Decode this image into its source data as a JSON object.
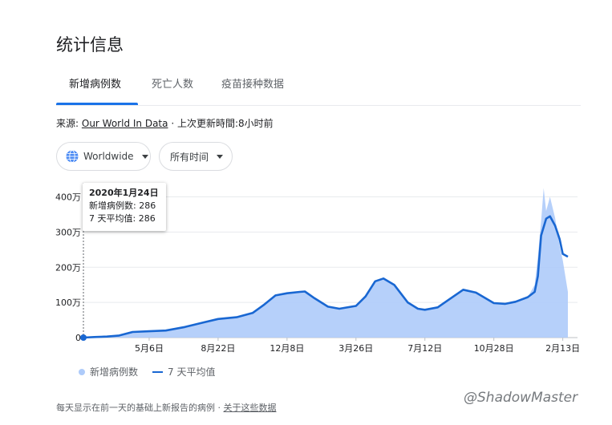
{
  "title": "统计信息",
  "tabs": [
    {
      "label": "新增病例数",
      "active": true
    },
    {
      "label": "死亡人数",
      "active": false
    },
    {
      "label": "疫苗接种数据",
      "active": false
    }
  ],
  "source": {
    "prefix": "来源:",
    "link": "Our World In Data",
    "sep": "·",
    "updated": "上次更新時間:",
    "age": "8小时前"
  },
  "filters": {
    "region": "Worldwide",
    "range": "所有时间"
  },
  "tooltip": {
    "date": "2020年1月24日",
    "cases_label": "新增病例数:",
    "cases_value": "286",
    "avg_label": "7 天平均值:",
    "avg_value": "286"
  },
  "legend": {
    "bars": "新增病例数",
    "line": "7 天平均值"
  },
  "footer": {
    "note": "每天显示在前一天的基础上新报告的病例",
    "sep": "·",
    "link": "关于这些数据"
  },
  "watermark": "@ShadowMaster",
  "colors": {
    "accent": "#1a73e8",
    "bars": "#aecbfa",
    "line": "#1967d2"
  },
  "chart_data": {
    "type": "area",
    "ylim": [
      0,
      4400000
    ],
    "y_ticks": [
      {
        "value": 0,
        "label": "0"
      },
      {
        "value": 1000000,
        "label": "100万"
      },
      {
        "value": 2000000,
        "label": "200万"
      },
      {
        "value": 3000000,
        "label": "300万"
      },
      {
        "value": 4000000,
        "label": "400万"
      }
    ],
    "x_range": [
      "2020-01-24",
      "2022-02-21"
    ],
    "x_ticks": [
      {
        "date": "2020-05-06",
        "label": "5月6日"
      },
      {
        "date": "2020-08-22",
        "label": "8月22日"
      },
      {
        "date": "2020-12-08",
        "label": "12月8日"
      },
      {
        "date": "2021-03-26",
        "label": "3月26日"
      },
      {
        "date": "2021-07-12",
        "label": "7月12日"
      },
      {
        "date": "2021-10-28",
        "label": "10月28日"
      },
      {
        "date": "2022-02-13",
        "label": "2月13日"
      }
    ],
    "grid": true,
    "series": [
      {
        "name": "7 天平均值",
        "points": [
          [
            "2020-01-24",
            286
          ],
          [
            "2020-02-10",
            15000
          ],
          [
            "2020-03-01",
            30000
          ],
          [
            "2020-03-20",
            60000
          ],
          [
            "2020-04-10",
            160000
          ],
          [
            "2020-05-06",
            180000
          ],
          [
            "2020-06-01",
            200000
          ],
          [
            "2020-07-01",
            300000
          ],
          [
            "2020-08-01",
            440000
          ],
          [
            "2020-08-22",
            530000
          ],
          [
            "2020-09-20",
            580000
          ],
          [
            "2020-10-15",
            700000
          ],
          [
            "2020-11-01",
            920000
          ],
          [
            "2020-11-20",
            1200000
          ],
          [
            "2020-12-08",
            1260000
          ],
          [
            "2020-12-28",
            1300000
          ],
          [
            "2021-01-05",
            1310000
          ],
          [
            "2021-01-20",
            1120000
          ],
          [
            "2021-02-10",
            880000
          ],
          [
            "2021-02-28",
            820000
          ],
          [
            "2021-03-26",
            900000
          ],
          [
            "2021-04-10",
            1170000
          ],
          [
            "2021-04-25",
            1600000
          ],
          [
            "2021-05-08",
            1680000
          ],
          [
            "2021-05-25",
            1500000
          ],
          [
            "2021-06-15",
            1000000
          ],
          [
            "2021-07-01",
            820000
          ],
          [
            "2021-07-12",
            790000
          ],
          [
            "2021-08-01",
            860000
          ],
          [
            "2021-08-20",
            1100000
          ],
          [
            "2021-09-10",
            1360000
          ],
          [
            "2021-09-30",
            1280000
          ],
          [
            "2021-10-28",
            980000
          ],
          [
            "2021-11-15",
            960000
          ],
          [
            "2021-12-01",
            1020000
          ],
          [
            "2021-12-20",
            1150000
          ],
          [
            "2021-12-31",
            1300000
          ],
          [
            "2022-01-05",
            1750000
          ],
          [
            "2022-01-10",
            2900000
          ],
          [
            "2022-01-18",
            3380000
          ],
          [
            "2022-01-24",
            3450000
          ],
          [
            "2022-02-01",
            3180000
          ],
          [
            "2022-02-08",
            2800000
          ],
          [
            "2022-02-13",
            2380000
          ],
          [
            "2022-02-21",
            2300000
          ]
        ]
      },
      {
        "name": "新增病例数",
        "points": [
          [
            "2020-01-24",
            286
          ],
          [
            "2020-02-10",
            15000
          ],
          [
            "2020-03-01",
            30000
          ],
          [
            "2020-03-20",
            60000
          ],
          [
            "2020-04-10",
            160000
          ],
          [
            "2020-05-06",
            180000
          ],
          [
            "2020-06-01",
            200000
          ],
          [
            "2020-07-01",
            300000
          ],
          [
            "2020-08-01",
            440000
          ],
          [
            "2020-08-22",
            530000
          ],
          [
            "2020-09-20",
            580000
          ],
          [
            "2020-10-15",
            700000
          ],
          [
            "2020-11-01",
            920000
          ],
          [
            "2020-11-20",
            1200000
          ],
          [
            "2020-12-08",
            1260000
          ],
          [
            "2020-12-28",
            1300000
          ],
          [
            "2021-01-05",
            1310000
          ],
          [
            "2021-01-20",
            1120000
          ],
          [
            "2021-02-10",
            880000
          ],
          [
            "2021-02-28",
            820000
          ],
          [
            "2021-03-26",
            900000
          ],
          [
            "2021-04-10",
            1170000
          ],
          [
            "2021-04-25",
            1600000
          ],
          [
            "2021-05-08",
            1680000
          ],
          [
            "2021-05-25",
            1500000
          ],
          [
            "2021-06-15",
            1000000
          ],
          [
            "2021-07-01",
            820000
          ],
          [
            "2021-07-12",
            790000
          ],
          [
            "2021-08-01",
            860000
          ],
          [
            "2021-08-20",
            1100000
          ],
          [
            "2021-09-10",
            1360000
          ],
          [
            "2021-09-30",
            1280000
          ],
          [
            "2021-10-28",
            980000
          ],
          [
            "2021-11-15",
            960000
          ],
          [
            "2021-12-01",
            1020000
          ],
          [
            "2021-12-20",
            1150000
          ],
          [
            "2021-12-31",
            1500000
          ],
          [
            "2022-01-05",
            2300000
          ],
          [
            "2022-01-10",
            3300000
          ],
          [
            "2022-01-14",
            4250000
          ],
          [
            "2022-01-18",
            3600000
          ],
          [
            "2022-01-24",
            4000000
          ],
          [
            "2022-02-01",
            3400000
          ],
          [
            "2022-02-08",
            2600000
          ],
          [
            "2022-02-13",
            2200000
          ],
          [
            "2022-02-21",
            1300000
          ]
        ]
      }
    ]
  }
}
